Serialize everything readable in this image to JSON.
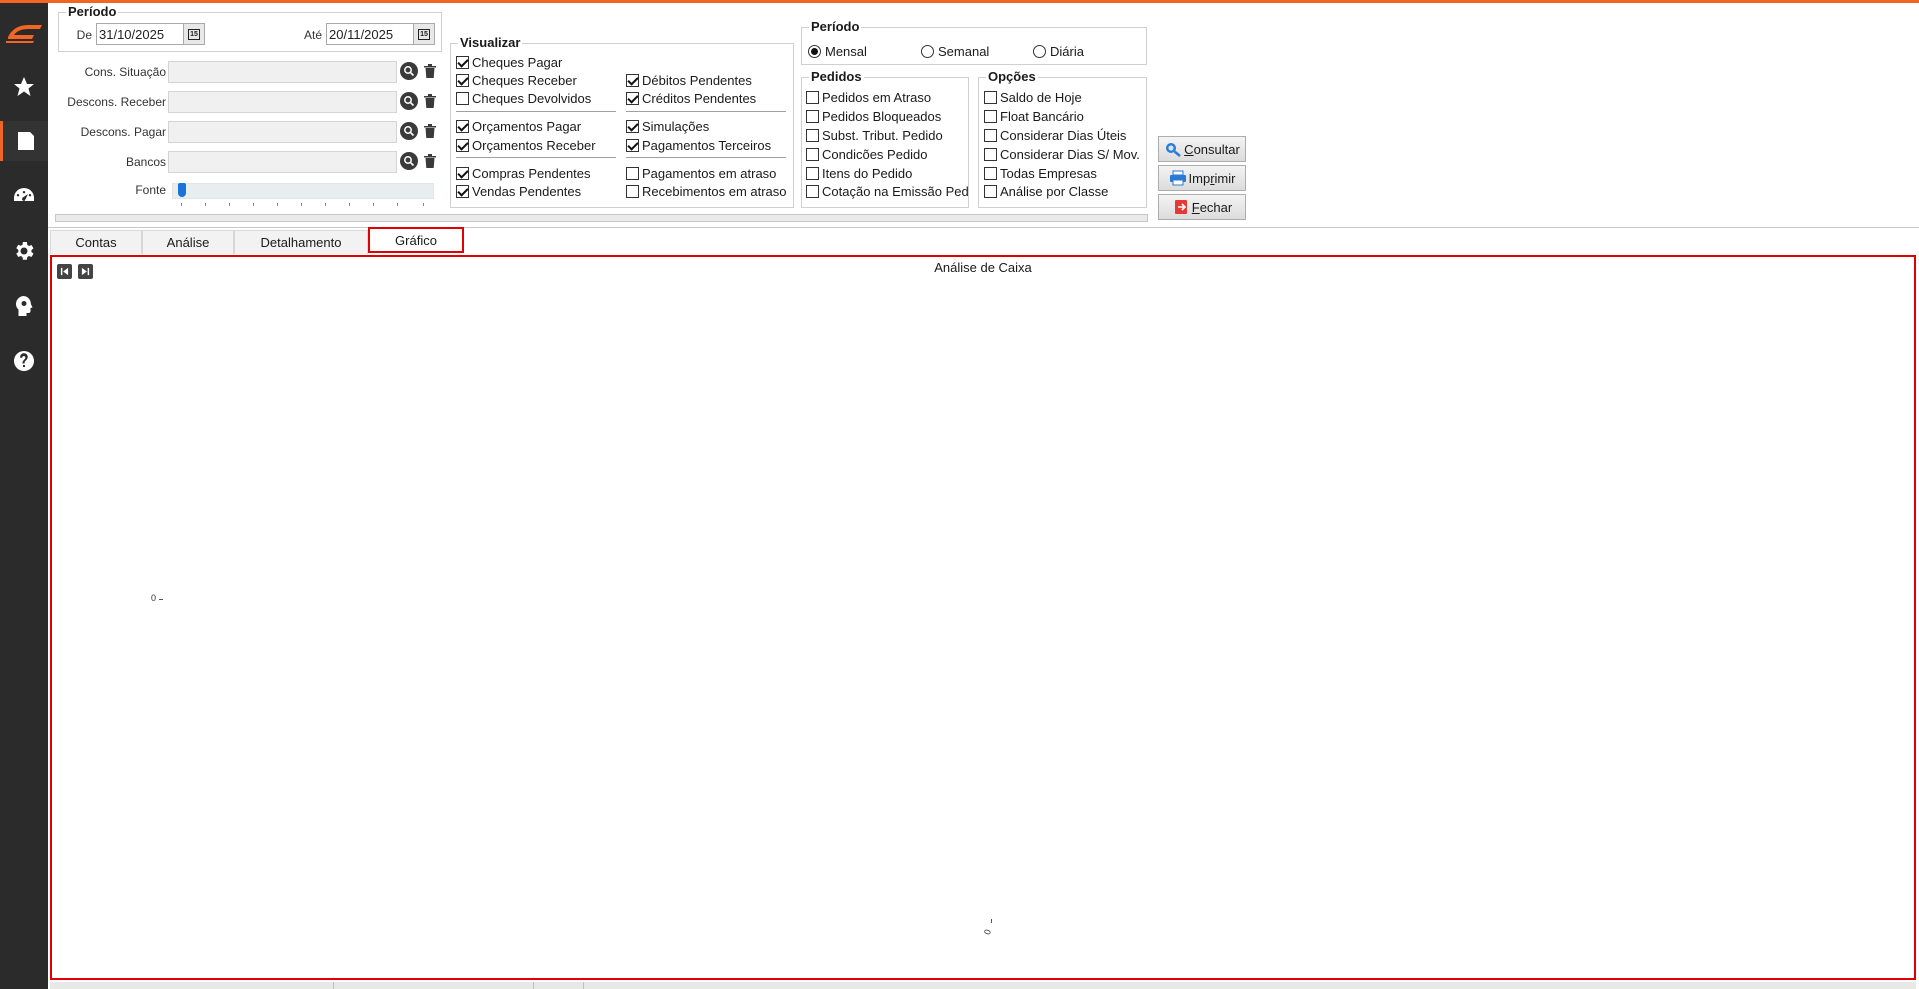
{
  "filters": {
    "periodo_legend": "Período",
    "de_label": "De",
    "de_value": "31/10/2025",
    "ate_label": "Até",
    "ate_value": "20/11/2025",
    "cons_situacao_label": "Cons. Situação",
    "descons_receber_label": "Descons. Receber",
    "descons_pagar_label": "Descons. Pagar",
    "bancos_label": "Bancos",
    "fonte_label": "Fonte"
  },
  "visualizar": {
    "legend": "Visualizar",
    "items": [
      {
        "label": "Cheques Pagar",
        "checked": true
      },
      {
        "label": "Cheques Receber",
        "checked": true
      },
      {
        "label": "Cheques Devolvidos",
        "checked": false
      },
      {
        "label": "Débitos Pendentes",
        "checked": true
      },
      {
        "label": "Créditos Pendentes",
        "checked": true
      },
      {
        "label": "Orçamentos Pagar",
        "checked": true
      },
      {
        "label": "Orçamentos Receber",
        "checked": true
      },
      {
        "label": "Simulações",
        "checked": true
      },
      {
        "label": "Pagamentos Terceiros",
        "checked": true
      },
      {
        "label": "Compras Pendentes",
        "checked": true
      },
      {
        "label": "Vendas Pendentes",
        "checked": true
      },
      {
        "label": "Pagamentos em atraso",
        "checked": false
      },
      {
        "label": "Recebimentos em atraso",
        "checked": false
      }
    ]
  },
  "periodo_group": {
    "legend": "Período",
    "options": [
      {
        "label": "Mensal",
        "selected": true
      },
      {
        "label": "Semanal",
        "selected": false
      },
      {
        "label": "Diária",
        "selected": false
      }
    ]
  },
  "pedidos": {
    "legend": "Pedidos",
    "items": [
      {
        "label": "Pedidos em Atraso",
        "checked": false
      },
      {
        "label": "Pedidos Bloqueados",
        "checked": false
      },
      {
        "label": "Subst. Tribut. Pedido",
        "checked": false
      },
      {
        "label": "Condicões Pedido",
        "checked": false
      },
      {
        "label": "Itens do Pedido",
        "checked": false
      },
      {
        "label": "Cotação na Emissão Ped",
        "checked": false
      }
    ]
  },
  "opcoes": {
    "legend": "Opções",
    "items": [
      {
        "label": "Saldo de Hoje",
        "checked": false
      },
      {
        "label": "Float Bancário",
        "checked": false
      },
      {
        "label": "Considerar Dias Úteis",
        "checked": false
      },
      {
        "label": "Considerar Dias S/ Mov.",
        "checked": false
      },
      {
        "label": "Todas Empresas",
        "checked": false
      },
      {
        "label": "Análise por Classe",
        "checked": false
      }
    ]
  },
  "actions": {
    "consultar_first": "C",
    "consultar_rest": "onsultar",
    "imprimir_first": "Imp",
    "imprimir_ul": "r",
    "imprimir_rest": "imir",
    "fechar_first": "F",
    "fechar_rest": "echar"
  },
  "tabs": [
    {
      "label": "Contas",
      "active": false
    },
    {
      "label": "Análise",
      "active": false
    },
    {
      "label": "Detalhamento",
      "active": false
    },
    {
      "label": "Gráfico",
      "active": true
    }
  ],
  "chart_data": {
    "type": "bar",
    "title": "Análise de Caixa",
    "categories": [
      "0"
    ],
    "values": [],
    "y_tick_labels": [
      "0"
    ],
    "xlabel": "",
    "ylabel": ""
  },
  "colors": {
    "accent": "#f26522",
    "highlight": "#e00000",
    "sidebar": "#2b2b2b"
  },
  "icons": {
    "sidebar": [
      "logo-icon",
      "star-icon",
      "report-icon",
      "dashboard-icon",
      "settings-icon",
      "head-gear-icon",
      "help-icon"
    ]
  }
}
